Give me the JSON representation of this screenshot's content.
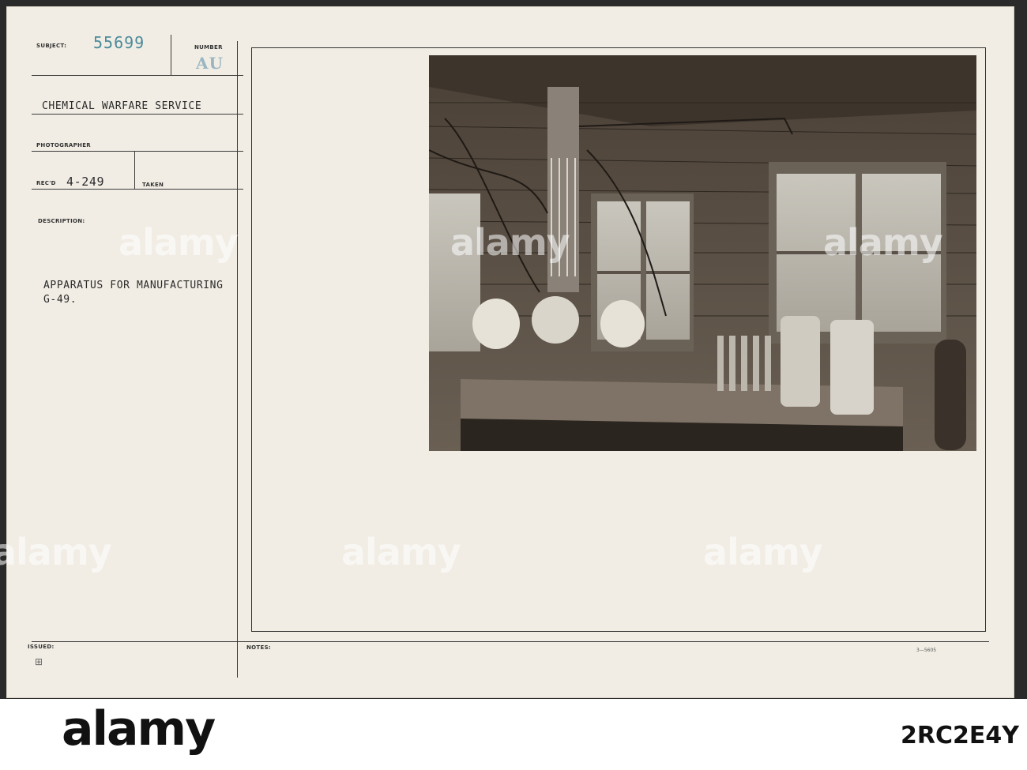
{
  "card": {
    "subject_label": "SUBJECT:",
    "subject_number": "55699",
    "number_label": "NUMBER",
    "number_stamp": "AU",
    "organization": "CHEMICAL WARFARE SERVICE",
    "photographer_label": "PHOTOGRAPHER",
    "recd_label": "REC'D",
    "recd_value": "4-249",
    "taken_label": "TAKEN",
    "description_label": "DESCRIPTION:",
    "description_line1": "APPARATUS FOR MANUFACTURING",
    "description_line2": "G-49.",
    "issued_label": "ISSUED:",
    "notes_label": "NOTES:",
    "form_code": "3—5605"
  },
  "watermark": {
    "text": "alamy",
    "small_mark": "a"
  },
  "footer": {
    "logo": "alamy",
    "image_id": "2RC2E4Y"
  },
  "colors": {
    "card_bg": "#f1ede4",
    "stamp_blue": "#4a8a9a",
    "photo_dark": "#3a332b"
  }
}
